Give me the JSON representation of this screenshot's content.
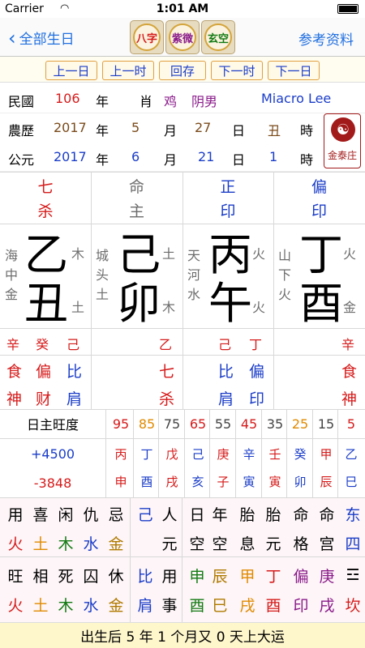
{
  "status": {
    "carrier": "Carrier",
    "time": "1:01 AM"
  },
  "nav": {
    "back_label": "全部生日",
    "right_label": "参考资料",
    "tiles": [
      "八字",
      "紫微",
      "玄空"
    ]
  },
  "buttons": [
    "上一日",
    "上一时",
    "回存",
    "下一时",
    "下一日"
  ],
  "info": {
    "minguo_label": "民國",
    "minguo_year": "106",
    "nian": "年",
    "xiao": "肖",
    "animal": "鸡",
    "gender": "阴男",
    "user": "Miacro Lee",
    "lunar_label": "農歷",
    "lunar_year": "2017",
    "lunar_month": "5",
    "yue": "月",
    "lunar_day": "27",
    "ri": "日",
    "hour_branch": "丑",
    "shi": "時",
    "solar_label": "公元",
    "solar_year": "2017",
    "solar_month": "6",
    "solar_day": "21",
    "solar_hour": "1"
  },
  "logo_text": "金泰庄",
  "pillars": [
    {
      "top1": "七",
      "top2": "杀",
      "nayin": [
        "海",
        "中",
        "金"
      ],
      "stem": "乙",
      "branch": "丑",
      "el1": "木",
      "el2": "土",
      "hidden": [
        "辛",
        "癸",
        "己"
      ],
      "gods1": [
        "食",
        "偏",
        "比"
      ],
      "gods2": [
        "神",
        "财",
        "肩"
      ]
    },
    {
      "top1": "命",
      "top2": "主",
      "nayin": [
        "城",
        "头",
        "土"
      ],
      "stem": "己",
      "branch": "卯",
      "el1": "土",
      "el2": "木",
      "hidden": [
        "乙"
      ],
      "gods1": [
        "七"
      ],
      "gods2": [
        "杀"
      ]
    },
    {
      "top1": "正",
      "top2": "印",
      "nayin": [
        "天",
        "河",
        "水"
      ],
      "stem": "丙",
      "branch": "午",
      "el1": "火",
      "el2": "火",
      "hidden": [
        "己",
        "丁"
      ],
      "gods1": [
        "比",
        "偏"
      ],
      "gods2": [
        "肩",
        "印"
      ]
    },
    {
      "top1": "偏",
      "top2": "印",
      "nayin": [
        "山",
        "下",
        "火"
      ],
      "stem": "丁",
      "branch": "酉",
      "el1": "火",
      "el2": "金",
      "hidden": [
        "辛"
      ],
      "gods1": [
        "食"
      ],
      "gods2": [
        "神"
      ]
    }
  ],
  "strength": {
    "label": "日主旺度",
    "values": [
      "95",
      "85",
      "75",
      "65",
      "55",
      "45",
      "35",
      "25",
      "15",
      "5"
    ],
    "plus": "+4500",
    "minus": "-3848",
    "stems": [
      "丙",
      "丁",
      "戊",
      "己",
      "庚",
      "辛",
      "壬",
      "癸",
      "甲",
      "乙"
    ],
    "branches": [
      "申",
      "酉",
      "戌",
      "亥",
      "子",
      "寅",
      "寅",
      "卯",
      "辰",
      "巳"
    ]
  },
  "use": {
    "row1": [
      "用",
      "喜",
      "闲",
      "仇",
      "忌"
    ],
    "row2": [
      "火",
      "土",
      "木",
      "水",
      "金"
    ],
    "row3": [
      "旺",
      "相",
      "死",
      "囚",
      "休"
    ],
    "row4": [
      "火",
      "土",
      "木",
      "水",
      "金"
    ]
  },
  "extra": {
    "c1": [
      "己",
      "比"
    ],
    "c2": [
      "人",
      "元",
      "用",
      "肩",
      "事"
    ],
    "rik": [
      "日",
      "空",
      "申",
      "酉"
    ],
    "nian": [
      "年",
      "空",
      "辰",
      "巳"
    ],
    "tx": [
      "胎",
      "息",
      "甲",
      "戌"
    ],
    "tyuan": [
      "胎",
      "元",
      "丁",
      "酉"
    ],
    "mg": [
      "命",
      "格",
      "偏",
      "印"
    ],
    "mgong": [
      "命",
      "宫",
      "庚",
      "戌"
    ],
    "dir": [
      "东",
      "四",
      "☲",
      "坎"
    ]
  },
  "bottom": "出生后 5 年 1 个月又 0 天上大运"
}
